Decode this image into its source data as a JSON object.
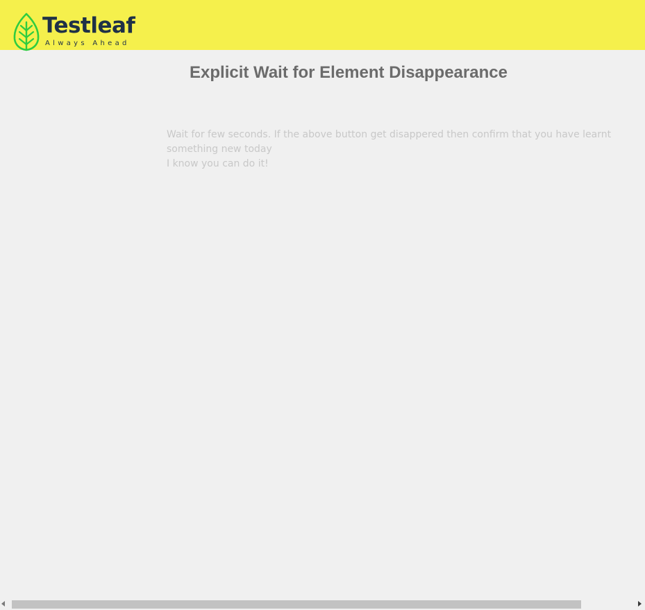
{
  "header": {
    "brand_name": "Testleaf",
    "brand_tagline": "Always Ahead",
    "logo_icon": "leaf-icon",
    "background_color": "#f5f04c",
    "brand_text_color": "#1f3147",
    "leaf_color": "#2ecc40"
  },
  "main": {
    "title": "Explicit Wait for Element Disappearance",
    "info_line_1": "Wait for few seconds. If the above button get disappered then confirm that you have learnt something new today",
    "info_line_2": "I know you can do it!"
  },
  "scrollbar": {
    "left_icon": "scroll-left-arrow-icon",
    "right_icon": "scroll-right-arrow-icon"
  }
}
